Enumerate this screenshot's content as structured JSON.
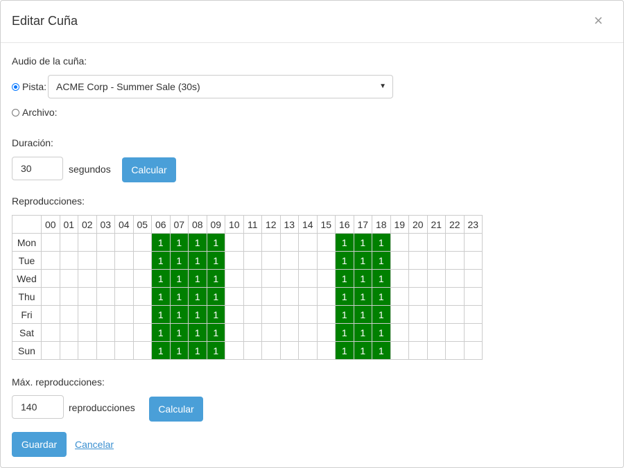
{
  "modal": {
    "title": "Editar Cuña",
    "close_glyph": "×"
  },
  "audio": {
    "label": "Audio de la cuña:",
    "track_option_label": "Pista:",
    "track_selected": true,
    "track_value": "ACME Corp - Summer Sale (30s)",
    "file_option_label": "Archivo:"
  },
  "duration": {
    "label": "Duración:",
    "value": "30",
    "unit": "segundos",
    "calc_label": "Calcular"
  },
  "plays": {
    "label": "Reproducciones:",
    "hours": [
      "00",
      "01",
      "02",
      "03",
      "04",
      "05",
      "06",
      "07",
      "08",
      "09",
      "10",
      "11",
      "12",
      "13",
      "14",
      "15",
      "16",
      "17",
      "18",
      "19",
      "20",
      "21",
      "22",
      "23"
    ],
    "days": [
      "Mon",
      "Tue",
      "Wed",
      "Thu",
      "Fri",
      "Sat",
      "Sun"
    ],
    "schedule": [
      [
        "",
        "",
        "",
        "",
        "",
        "",
        "1",
        "1",
        "1",
        "1",
        "",
        "",
        "",
        "",
        "",
        "",
        "1",
        "1",
        "1",
        "",
        "",
        "",
        "",
        ""
      ],
      [
        "",
        "",
        "",
        "",
        "",
        "",
        "1",
        "1",
        "1",
        "1",
        "",
        "",
        "",
        "",
        "",
        "",
        "1",
        "1",
        "1",
        "",
        "",
        "",
        "",
        ""
      ],
      [
        "",
        "",
        "",
        "",
        "",
        "",
        "1",
        "1",
        "1",
        "1",
        "",
        "",
        "",
        "",
        "",
        "",
        "1",
        "1",
        "1",
        "",
        "",
        "",
        "",
        ""
      ],
      [
        "",
        "",
        "",
        "",
        "",
        "",
        "1",
        "1",
        "1",
        "1",
        "",
        "",
        "",
        "",
        "",
        "",
        "1",
        "1",
        "1",
        "",
        "",
        "",
        "",
        ""
      ],
      [
        "",
        "",
        "",
        "",
        "",
        "",
        "1",
        "1",
        "1",
        "1",
        "",
        "",
        "",
        "",
        "",
        "",
        "1",
        "1",
        "1",
        "",
        "",
        "",
        "",
        ""
      ],
      [
        "",
        "",
        "",
        "",
        "",
        "",
        "1",
        "1",
        "1",
        "1",
        "",
        "",
        "",
        "",
        "",
        "",
        "1",
        "1",
        "1",
        "",
        "",
        "",
        "",
        ""
      ],
      [
        "",
        "",
        "",
        "",
        "",
        "",
        "1",
        "1",
        "1",
        "1",
        "",
        "",
        "",
        "",
        "",
        "",
        "1",
        "1",
        "1",
        "",
        "",
        "",
        "",
        ""
      ]
    ]
  },
  "max_plays": {
    "label": "Máx. reproducciones:",
    "value": "140",
    "unit": "reproducciones",
    "calc_label": "Calcular"
  },
  "footer": {
    "save_label": "Guardar",
    "cancel_label": "Cancelar"
  },
  "colors": {
    "active_cell": "#008000",
    "primary_button": "#4a9fd8",
    "link": "#3a8fd0"
  }
}
